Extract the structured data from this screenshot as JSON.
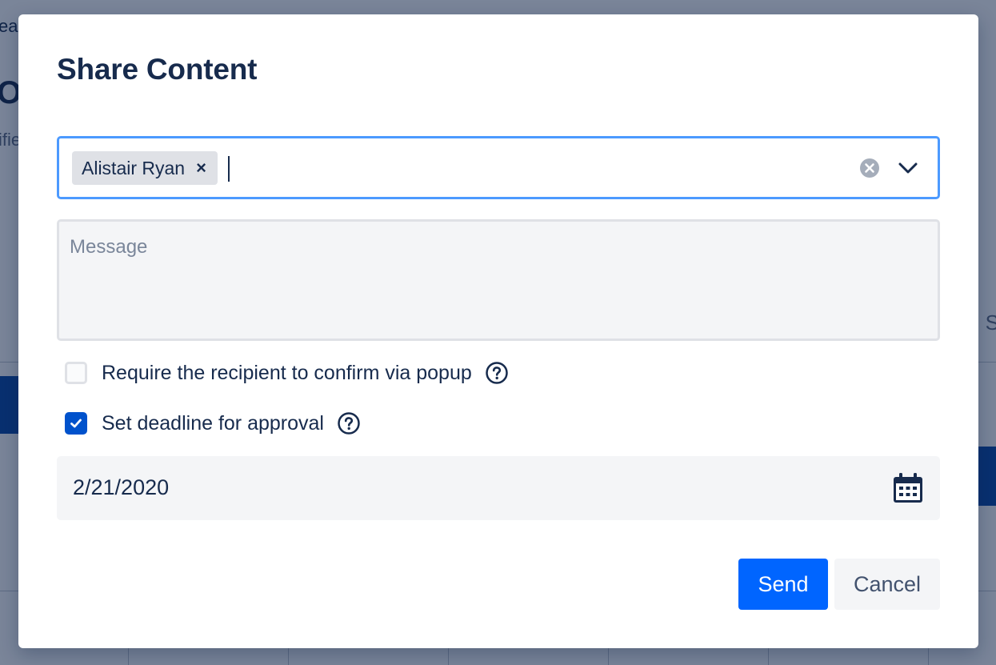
{
  "background": {
    "fragments": [
      "ea",
      "O",
      "ifie",
      "S"
    ]
  },
  "modal": {
    "title": "Share Content",
    "recipients": {
      "chips": [
        {
          "label": "Alistair Ryan",
          "remove_glyph": "×"
        }
      ],
      "icons": {
        "clear": "clear-icon",
        "dropdown": "chevron-down-icon"
      }
    },
    "message": {
      "value": "",
      "placeholder": "Message"
    },
    "options": [
      {
        "label": "Require the recipient to confirm via popup",
        "checked": false
      },
      {
        "label": "Set deadline for approval",
        "checked": true
      }
    ],
    "deadline": {
      "value": "2/21/2020",
      "icon": "calendar-icon"
    },
    "actions": {
      "send_label": "Send",
      "cancel_label": "Cancel"
    }
  },
  "colors": {
    "accent": "#0065ff",
    "checkbox_checked": "#0052cc",
    "focus_border": "#4c9aff",
    "text": "#172b4d",
    "overlay": "#7a8296"
  }
}
